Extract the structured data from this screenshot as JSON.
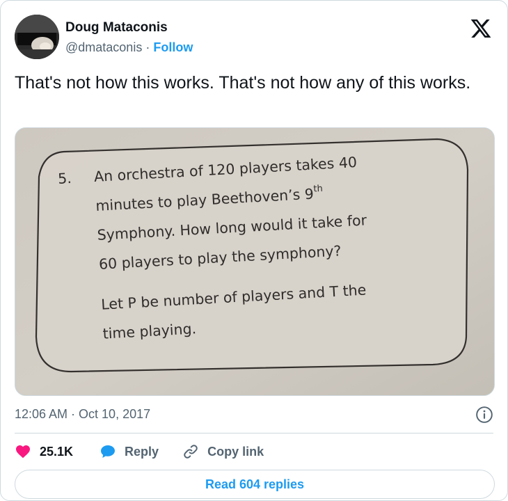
{
  "author": {
    "name": "Doug Mataconis",
    "handle": "@dmataconis",
    "separator": "·",
    "follow_label": "Follow"
  },
  "tweet": {
    "text": "That's not how this works. That's not how any of this works."
  },
  "photo": {
    "problem_number": "5.",
    "lines": [
      "An orchestra of 120 players takes 40",
      "minutes to play Beethoven’s 9",
      "Symphony. How long would it take for",
      "60 players to play the symphony?"
    ],
    "superscript": "th",
    "lines2": [
      "Let P be number of players and T the",
      "time playing."
    ]
  },
  "meta": {
    "timestamp": "12:06 AM · Oct 10, 2017"
  },
  "actions": {
    "likes_count": "25.1K",
    "reply_label": "Reply",
    "copy_link_label": "Copy link"
  },
  "footer": {
    "read_replies_label": "Read 604 replies"
  },
  "colors": {
    "accent": "#1d9bf0",
    "like": "#f91880",
    "text": "#0f1419",
    "muted": "#536471",
    "border": "#cfd9de"
  },
  "icons": {
    "close": "x-logo-icon",
    "info": "info-icon",
    "like": "heart-icon",
    "reply": "reply-bubble-icon",
    "copy_link": "link-icon"
  }
}
